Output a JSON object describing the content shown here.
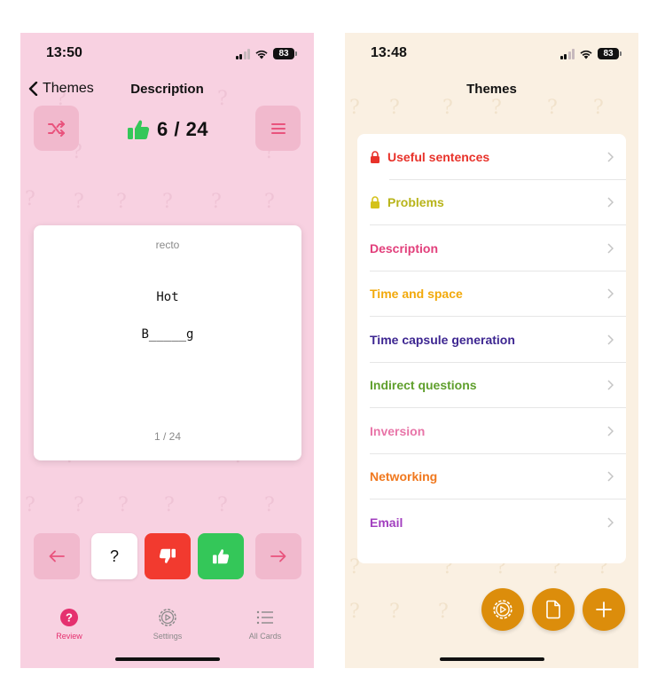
{
  "left": {
    "status": {
      "time": "13:50",
      "battery": "83"
    },
    "nav": {
      "back_label": "Themes",
      "title": "Description"
    },
    "score": {
      "text": "6 / 24"
    },
    "card": {
      "label": "recto",
      "question": "Hot",
      "answer": "B_____g",
      "count": "1 / 24"
    },
    "answer_buttons": {
      "question_mark": "?"
    },
    "tabs": [
      {
        "label": "Review",
        "icon": "question-circle-icon",
        "active": true
      },
      {
        "label": "Settings",
        "icon": "gear-icon",
        "active": false
      },
      {
        "label": "All Cards",
        "icon": "list-icon",
        "active": false
      }
    ],
    "colors": {
      "background": "#f8d1e1",
      "accent": "#e5306f",
      "up": "#34c759",
      "down": "#f23a2f"
    }
  },
  "right": {
    "status": {
      "time": "13:48",
      "battery": "83"
    },
    "nav": {
      "title": "Themes"
    },
    "themes": [
      {
        "label": "Useful sentences",
        "color": "#e8322a",
        "locked": true
      },
      {
        "label": "Problems",
        "color": "#b8b41a",
        "locked": true
      },
      {
        "label": "Description",
        "color": "#e23f7b",
        "locked": false
      },
      {
        "label": "Time and space",
        "color": "#f2a90b",
        "locked": false
      },
      {
        "label": "Time capsule generation",
        "color": "#3d2691",
        "locked": false
      },
      {
        "label": "Indirect questions",
        "color": "#5f9f2c",
        "locked": false
      },
      {
        "label": "Inversion",
        "color": "#e875a8",
        "locked": false
      },
      {
        "label": "Networking",
        "color": "#f0781e",
        "locked": false
      },
      {
        "label": "Email",
        "color": "#a23fbf",
        "locked": false
      }
    ],
    "fabs": [
      "settings-icon",
      "document-icon",
      "plus-icon"
    ],
    "colors": {
      "background": "#faf0e2",
      "fab": "#dc8d0b"
    }
  }
}
